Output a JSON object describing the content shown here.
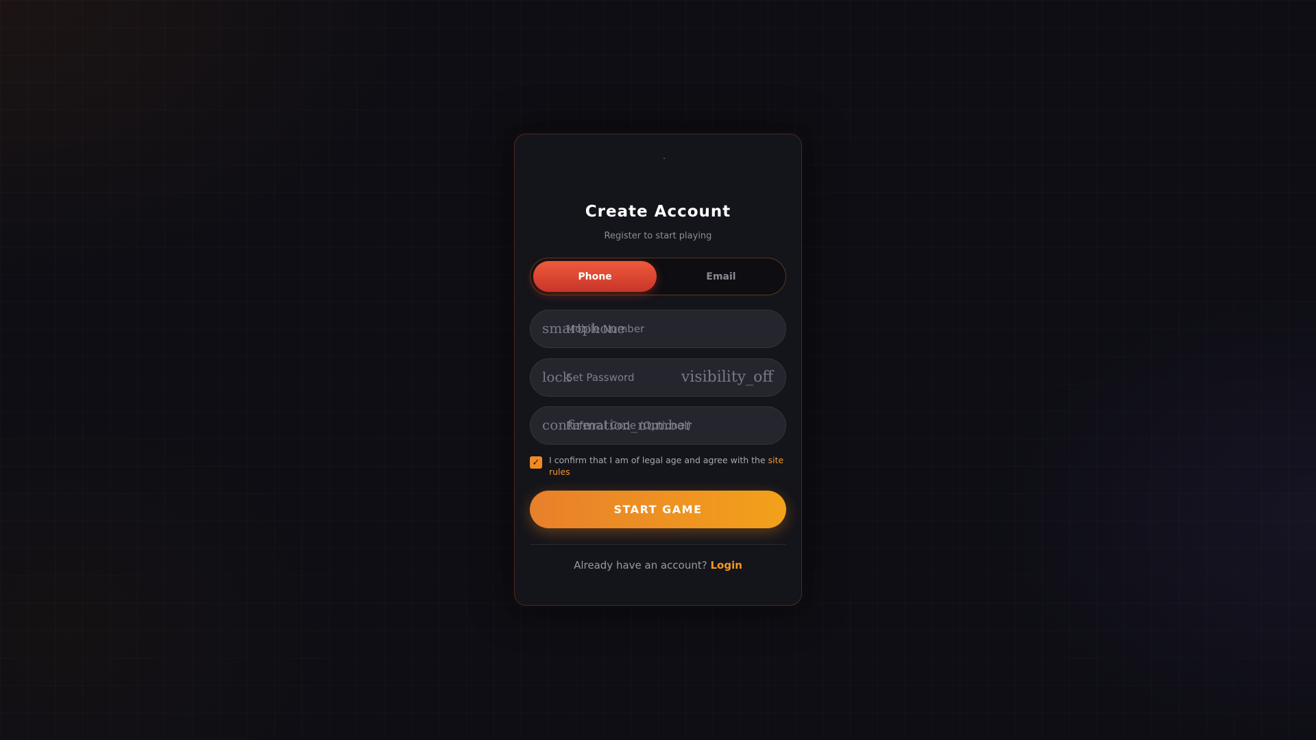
{
  "logo": {
    "text": "-"
  },
  "header": {
    "title": "Create Account",
    "subtitle": "Register to start playing"
  },
  "tabs": [
    {
      "label": "Phone",
      "active": true
    },
    {
      "label": "Email",
      "active": false
    }
  ],
  "fields": {
    "mobile": {
      "icon": "smartphone",
      "placeholder": "Mobile Number",
      "value": ""
    },
    "password": {
      "icon": "lock",
      "placeholder": "Set Password",
      "value": "",
      "toggle_icon": "visibility_off"
    },
    "referral": {
      "icon": "confirmation_number",
      "placeholder": "Referral Code (Optional)",
      "value": ""
    }
  },
  "agreement": {
    "checked": true,
    "check_glyph": "✓",
    "text": "I confirm that I am of legal age and agree with the ",
    "link": "site rules"
  },
  "start_button": {
    "label": "START GAME"
  },
  "footer": {
    "text": "Already have an account? ",
    "link": "Login"
  },
  "colors": {
    "accent_orange": "#f39a1c",
    "tab_active_red": "#e04a32",
    "card_border": "#4a2a22",
    "card_bg": "#14141b"
  }
}
